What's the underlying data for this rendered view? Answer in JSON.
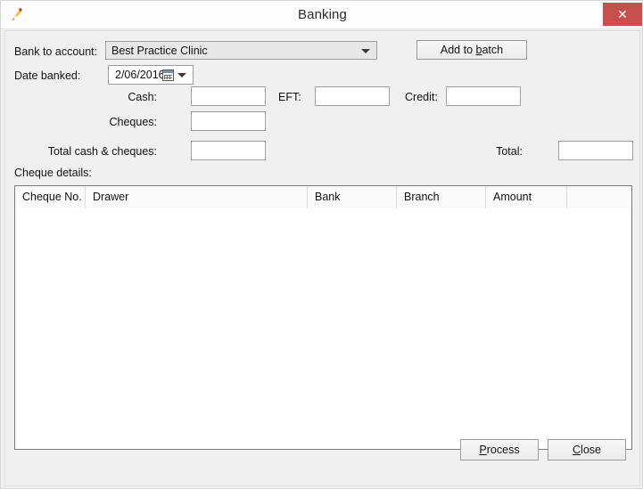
{
  "window": {
    "title": "Banking",
    "app_icon": "bird-icon",
    "close_label": "✕",
    "close_color": "#c7504f"
  },
  "form": {
    "bank_to_account": {
      "label": "Bank to account:",
      "value": "Best Practice Clinic",
      "options": [
        "Best Practice Clinic"
      ]
    },
    "date_banked": {
      "label": "Date banked:",
      "value": "2/06/2016"
    },
    "add_to_batch": {
      "label": "Add to batch",
      "accelerator": "b"
    },
    "cash": {
      "label": "Cash:",
      "value": "",
      "placeholder": ""
    },
    "eft": {
      "label": "EFT:",
      "value": "",
      "placeholder": ""
    },
    "credit": {
      "label": "Credit:",
      "value": "",
      "placeholder": ""
    },
    "cheques": {
      "label": "Cheques:",
      "value": "",
      "placeholder": ""
    },
    "total_cash_cheques": {
      "label": "Total cash & cheques:",
      "value": "",
      "placeholder": ""
    },
    "total": {
      "label": "Total:",
      "value": "",
      "placeholder": ""
    }
  },
  "cheque_details": {
    "label": "Cheque details:",
    "columns": [
      {
        "key": "cheque_no",
        "label": "Cheque No."
      },
      {
        "key": "drawer",
        "label": "Drawer"
      },
      {
        "key": "bank",
        "label": "Bank"
      },
      {
        "key": "branch",
        "label": "Branch"
      },
      {
        "key": "amount",
        "label": "Amount"
      },
      {
        "key": "spacer",
        "label": ""
      }
    ],
    "rows": []
  },
  "footer": {
    "process": {
      "label": "Process",
      "accelerator": "P"
    },
    "close": {
      "label": "Close",
      "accelerator": "C"
    }
  }
}
